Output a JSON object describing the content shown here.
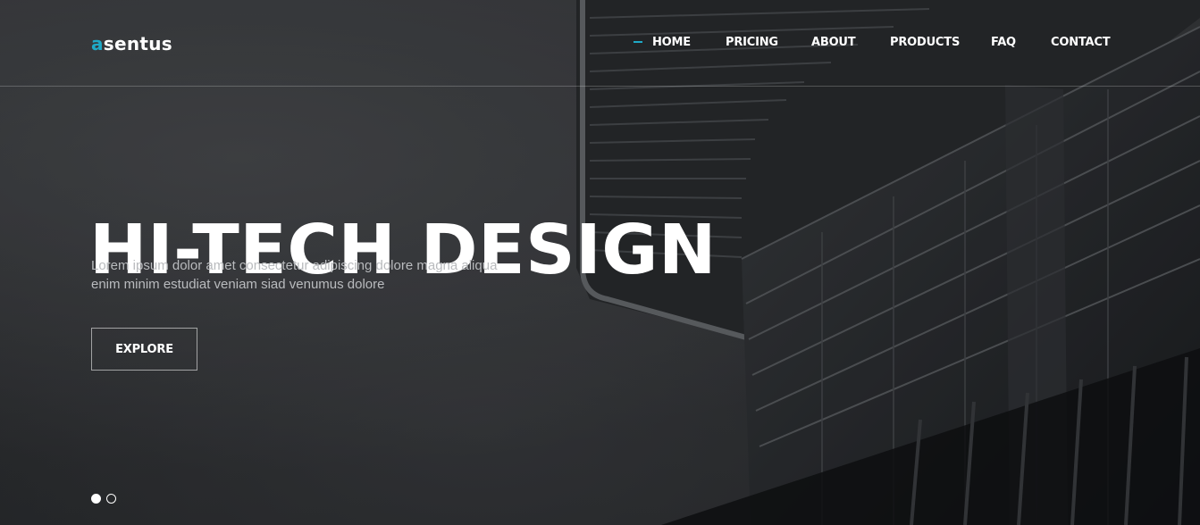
{
  "brand": {
    "logo_accent": "a",
    "logo_rest": "sentus",
    "accent_color": "#1fa9c6"
  },
  "nav": {
    "items": [
      {
        "label": "HOME",
        "active": true
      },
      {
        "label": "PRICING",
        "active": false
      },
      {
        "label": "ABOUT",
        "active": false
      },
      {
        "label": "PRODUCTS",
        "active": false
      },
      {
        "label": "FAQ",
        "active": false
      },
      {
        "label": "CONTACT",
        "active": false
      }
    ]
  },
  "hero": {
    "title": "HI-TECH DESIGN",
    "subtitle_line1": "Lorem ipsum dolor amet consectetur adipiscing dolore magna aliqua",
    "subtitle_line2": "enim minim estudiat veniam siad venumus dolore",
    "cta_label": "EXPLORE",
    "background_icon": "building-photo"
  },
  "slider": {
    "slide_count": 2,
    "active_slide": 1
  }
}
